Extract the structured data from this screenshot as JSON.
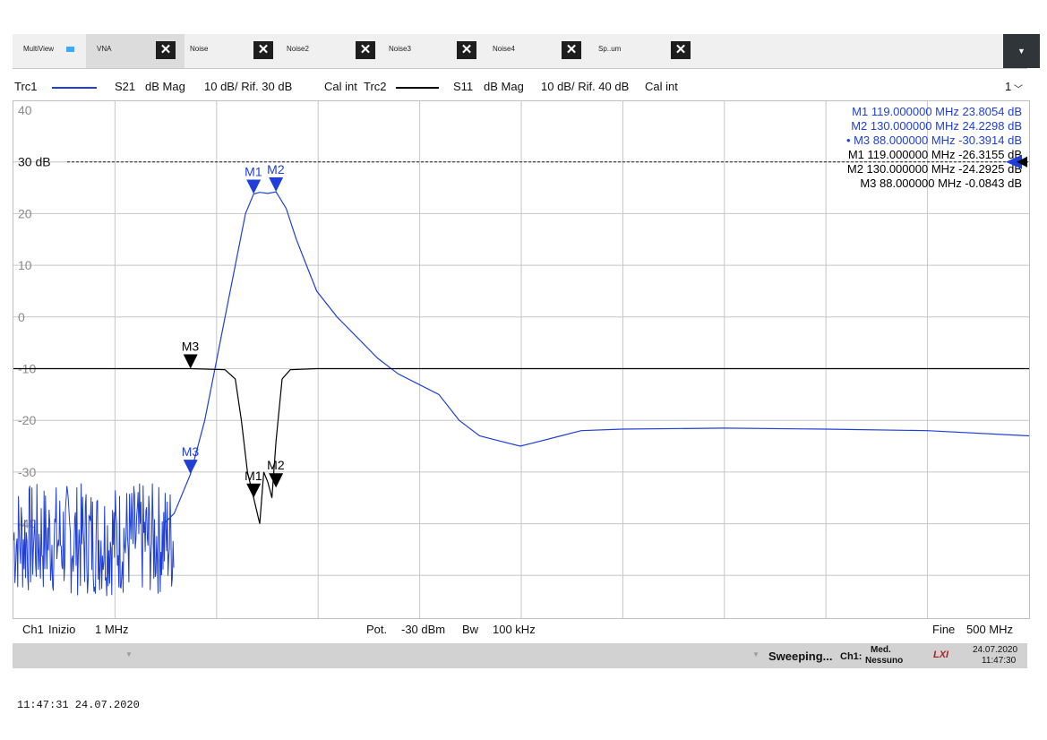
{
  "tabs": [
    {
      "label": "MultiView",
      "active": false,
      "closable": false
    },
    {
      "label": "VNA",
      "active": true,
      "closable": true
    },
    {
      "label": "Noise",
      "active": false,
      "closable": true
    },
    {
      "label": "Noise2",
      "active": false,
      "closable": true
    },
    {
      "label": "Noise3",
      "active": false,
      "closable": true
    },
    {
      "label": "Noise4",
      "active": false,
      "closable": true
    },
    {
      "label": "Sp..um",
      "active": false,
      "closable": true
    }
  ],
  "menu_icon": "chevron-down-icon",
  "traces": {
    "trc1": {
      "name": "Trc1",
      "param": "S21",
      "format": "dB Mag",
      "scale": "10 dB/ Rif. 30 dB",
      "cal": "Cal int",
      "color": "#1f3fd8"
    },
    "trc2": {
      "name": "Trc2",
      "param": "S11",
      "format": "dB Mag",
      "scale": "10 dB/ Rif. 40 dB",
      "cal": "Cal int",
      "color": "#000000"
    }
  },
  "diagram_number": "1",
  "chart_data": {
    "type": "line",
    "x_unit": "MHz",
    "xlim": [
      1,
      500
    ],
    "ylim": [
      -50,
      40
    ],
    "yticks": [
      {
        "value": 40,
        "label": "40"
      },
      {
        "value": 30,
        "label": "30 dB"
      },
      {
        "value": 20,
        "label": "20"
      },
      {
        "value": 10,
        "label": "10"
      },
      {
        "value": 0,
        "label": "0"
      },
      {
        "value": -10,
        "label": "-10"
      },
      {
        "value": -20,
        "label": "-20"
      },
      {
        "value": -30,
        "label": "-30"
      },
      {
        "value": -40,
        "label": "-40"
      }
    ],
    "reference_line": 30,
    "grid": true,
    "series": [
      {
        "name": "Trc1",
        "color": "#1f3fd8",
        "points": [
          [
            1,
            -44
          ],
          [
            25,
            -42
          ],
          [
            50,
            -41
          ],
          [
            75,
            -40
          ],
          [
            80,
            -38
          ],
          [
            88,
            -30.4
          ],
          [
            95,
            -20
          ],
          [
            100,
            -10
          ],
          [
            105,
            0
          ],
          [
            110,
            10
          ],
          [
            115,
            20
          ],
          [
            119,
            23.8
          ],
          [
            122,
            24.1
          ],
          [
            126,
            23.9
          ],
          [
            130,
            24.2
          ],
          [
            135,
            21
          ],
          [
            140,
            15
          ],
          [
            145,
            10
          ],
          [
            150,
            5
          ],
          [
            160,
            0
          ],
          [
            170,
            -4
          ],
          [
            180,
            -8
          ],
          [
            190,
            -11
          ],
          [
            200,
            -13
          ],
          [
            210,
            -15
          ],
          [
            220,
            -20
          ],
          [
            230,
            -23
          ],
          [
            240,
            -24
          ],
          [
            250,
            -25
          ],
          [
            260,
            -24
          ],
          [
            270,
            -23
          ],
          [
            280,
            -22
          ],
          [
            300,
            -21.7
          ],
          [
            350,
            -21.5
          ],
          [
            400,
            -21.7
          ],
          [
            450,
            -22
          ],
          [
            500,
            -23
          ]
        ],
        "markers": [
          {
            "name": "M1",
            "freq": "119.000000",
            "unit": "MHz",
            "value": "23.8054",
            "value_unit": "dB",
            "x": 119,
            "y": 23.8054
          },
          {
            "name": "M2",
            "freq": "130.000000",
            "unit": "MHz",
            "value": "24.2298",
            "value_unit": "dB",
            "x": 130,
            "y": 24.2298
          },
          {
            "name": "M3",
            "freq": "88.000000",
            "unit": "MHz",
            "value": "-30.3914",
            "value_unit": "dB",
            "x": 88,
            "y": -30.3914,
            "active": true
          }
        ]
      },
      {
        "name": "Trc2",
        "color": "#000000",
        "points": [
          [
            1,
            -10
          ],
          [
            50,
            -10
          ],
          [
            88,
            -10
          ],
          [
            105,
            -10.2
          ],
          [
            110,
            -12
          ],
          [
            113,
            -20
          ],
          [
            116,
            -30
          ],
          [
            119,
            -35
          ],
          [
            122,
            -40
          ],
          [
            124,
            -30
          ],
          [
            126,
            -32
          ],
          [
            128,
            -35
          ],
          [
            130,
            -24
          ],
          [
            133,
            -12
          ],
          [
            137,
            -10.2
          ],
          [
            150,
            -10
          ],
          [
            250,
            -10
          ],
          [
            350,
            -10
          ],
          [
            500,
            -10
          ]
        ],
        "markers": [
          {
            "name": "M1",
            "freq": "119.000000",
            "unit": "MHz",
            "value": "-26.3155",
            "value_unit": "dB",
            "x": 119,
            "y": -35
          },
          {
            "name": "M2",
            "freq": "130.000000",
            "unit": "MHz",
            "value": "-24.2925",
            "value_unit": "dB",
            "x": 130,
            "y": -33
          },
          {
            "name": "M3",
            "freq": "88.000000",
            "unit": "MHz",
            "value": "-0.0843",
            "value_unit": "dB",
            "x": 88,
            "y": -10
          }
        ]
      }
    ]
  },
  "bottom": {
    "channel": "Ch1",
    "start_label": "Inizio",
    "start_value": "1 MHz",
    "power_label": "Pot.",
    "power_value": "-30 dBm",
    "bw_label": "Bw",
    "bw_value": "100 kHz",
    "stop_label": "Fine",
    "stop_value": "500 MHz"
  },
  "status": {
    "sweep": "Sweeping...",
    "channel": "Ch1:",
    "avg_top": "Med.",
    "avg_bottom": "Nessuno",
    "lxi": "LXI",
    "date": "24.07.2020",
    "time": "11:47:30"
  },
  "footer_timestamp": "11:47:31  24.07.2020"
}
